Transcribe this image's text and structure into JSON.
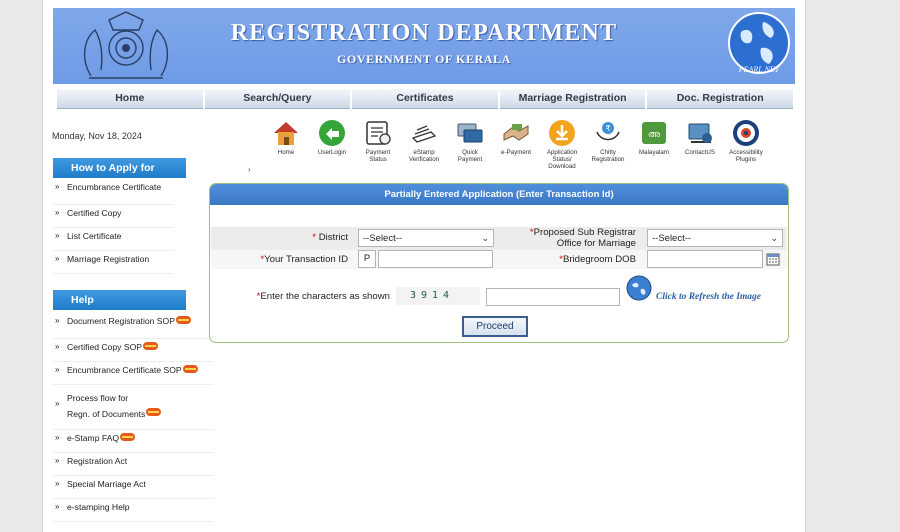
{
  "header": {
    "title": "REGISTRATION DEPARTMENT",
    "subtitle": "GOVERNMENT OF KERALA",
    "globe_text": "PEARL NET"
  },
  "nav": {
    "items": [
      {
        "label": "Home"
      },
      {
        "label": "Search/Query"
      },
      {
        "label": "Certificates"
      },
      {
        "label": "Marriage Registration"
      },
      {
        "label": "Doc. Registration"
      }
    ]
  },
  "date": "Monday, Nov 18, 2024",
  "icons": [
    {
      "label": "Home",
      "icon": "home-icon"
    },
    {
      "label": "UserLogin",
      "icon": "user-login-icon"
    },
    {
      "label": "Payment\nStatus",
      "icon": "payment-status-icon"
    },
    {
      "label": "eStamp\nVerification",
      "icon": "estamp-icon"
    },
    {
      "label": "Quick\nPayment",
      "icon": "quick-payment-icon"
    },
    {
      "label": "e-Payment",
      "icon": "e-payment-icon"
    },
    {
      "label": "Application\nStatus/\nDownload",
      "icon": "application-status-icon"
    },
    {
      "label": "Chitty\nRegistration",
      "icon": "chitty-icon"
    },
    {
      "label": "Malayalam",
      "icon": "malayalam-icon"
    },
    {
      "label": "ContactUS",
      "icon": "contact-icon"
    },
    {
      "label": "Accessibility\nPlugins",
      "icon": "accessibility-icon"
    }
  ],
  "sidebar": {
    "how_to_apply": {
      "heading": "How to Apply for",
      "items": [
        {
          "label": "Encumbrance Certificate"
        },
        {
          "label": "Certified Copy"
        },
        {
          "label": "List Certificate"
        },
        {
          "label": "Marriage Registration"
        }
      ]
    },
    "help": {
      "heading": "Help",
      "items": [
        {
          "label": "Document Registration SOP",
          "new": true
        },
        {
          "label": "Certified Copy SOP",
          "new": true
        },
        {
          "label": "Encumbrance Certificate SOP",
          "new": true
        },
        {
          "label_line1": "Process flow for",
          "label_line2": "Regn. of Documents",
          "new": true
        },
        {
          "label": "e-Stamp FAQ",
          "new": true
        },
        {
          "label": "Registration Act"
        },
        {
          "label": "Special Marriage Act"
        },
        {
          "label": "e-stamping Help"
        }
      ]
    }
  },
  "form": {
    "title": "Partially Entered Application (Enter Transaction Id)",
    "district": {
      "label": "District",
      "required_mark": "*",
      "value": "--Select--"
    },
    "sub_registrar": {
      "label_line1": "Proposed Sub Registrar",
      "label_line2": "Office for Marriage",
      "required_mark": "*",
      "value": "--Select--"
    },
    "transaction_id": {
      "label": "Your Transaction ID",
      "required_mark": "*",
      "prefix": "P",
      "value": ""
    },
    "bridegroom_dob": {
      "label": "Bridegroom DOB",
      "required_mark": "*",
      "value": ""
    },
    "captcha": {
      "label": "Enter the characters as shown",
      "required_mark": "*",
      "text": "3914",
      "value": ""
    },
    "refresh_label": "Click to Refresh the Image",
    "proceed_label": "Proceed"
  },
  "colors": {
    "banner": "#6f9be6",
    "sidebar_heading": "#1f7cc9",
    "form_header": "#3b78c6",
    "required": "#dd0000"
  }
}
